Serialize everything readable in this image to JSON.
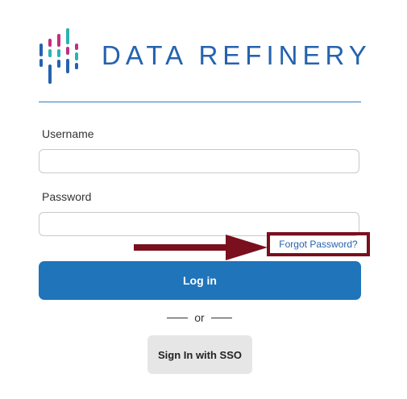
{
  "brand": {
    "name": "DATA REFINERY",
    "logo_icon": "bar-pattern-logo-icon",
    "colors": {
      "blue": "#2563ae",
      "teal": "#2bb3b0",
      "magenta": "#c0307d"
    }
  },
  "form": {
    "username_label": "Username",
    "username_value": "",
    "password_label": "Password",
    "password_value": "",
    "forgot_password": "Forgot Password?",
    "login_label": "Log in",
    "or_text": "or",
    "sso_label": "Sign In with SSO"
  },
  "annotation": {
    "arrow_icon": "right-arrow-icon",
    "highlight_color": "#7a0f1e"
  },
  "colors": {
    "primary_button": "#1f74ba",
    "secondary_button": "#e6e6e6",
    "link": "#2563ae"
  }
}
